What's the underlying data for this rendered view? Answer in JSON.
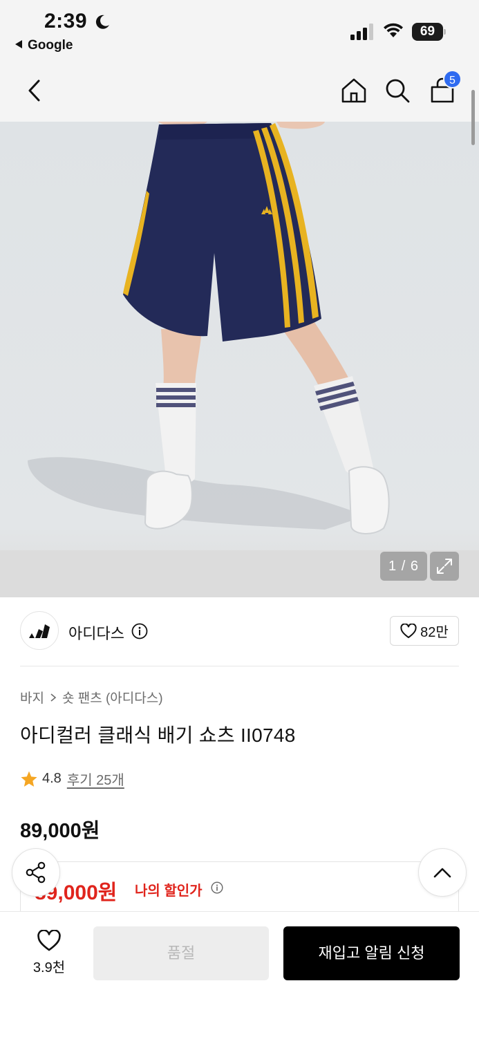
{
  "status_bar": {
    "time": "2:39",
    "back_app": "Google",
    "battery": "69"
  },
  "nav": {
    "cart_count": "5"
  },
  "gallery": {
    "counter": "1 / 6"
  },
  "brand": {
    "name": "아디다스",
    "likes": "82만"
  },
  "product": {
    "breadcrumb": [
      "바지",
      "숏 팬츠 (아디다스)"
    ],
    "title": "아디컬러 클래식 배기 쇼츠 II0748",
    "rating": "4.8",
    "reviews": "후기 25개",
    "price": "89,000원",
    "discount_price": "89,000원",
    "discount_label": "나의 할인가"
  },
  "bottom_bar": {
    "wish_count": "3.9천",
    "soldout_label": "품절",
    "restock_label": "재입고 알림 신청"
  },
  "colors": {
    "accent_red": "#e0241c",
    "badge_blue": "#2f6bf0",
    "shorts_navy": "#232a58",
    "stripe_yellow": "#e8b321"
  },
  "icons": [
    "moon-icon",
    "signal-icon",
    "wifi-icon",
    "back-icon",
    "home-icon",
    "search-icon",
    "cart-icon",
    "expand-icon",
    "info-icon",
    "heart-icon",
    "star-icon",
    "share-icon",
    "chevron-up-icon"
  ]
}
